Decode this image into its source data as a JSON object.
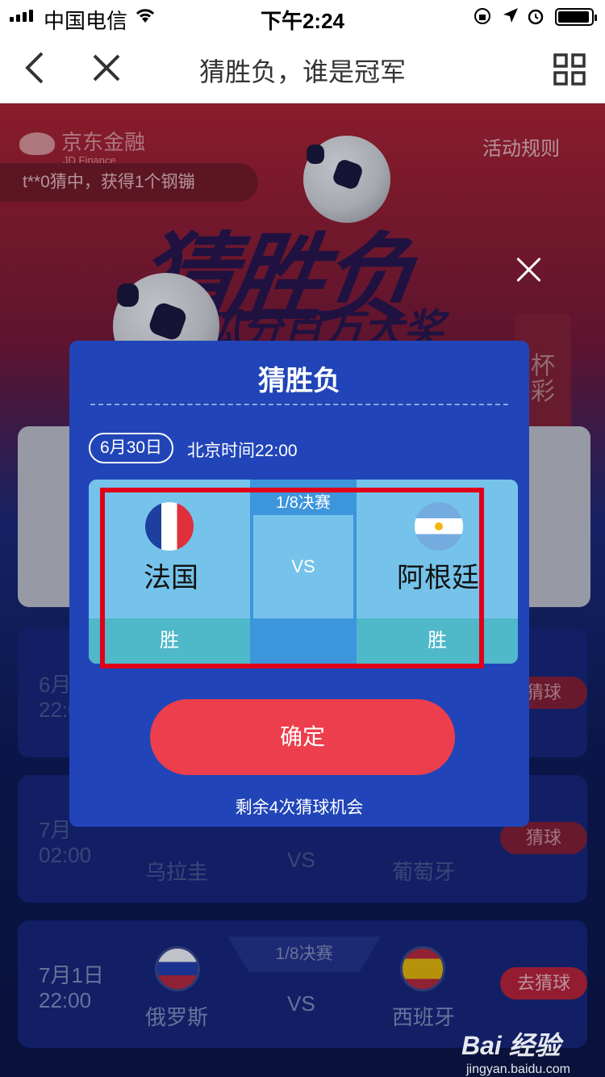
{
  "status_bar": {
    "carrier": "中国电信",
    "time": "下午2:24"
  },
  "nav": {
    "title": "猜胜负，谁是冠军"
  },
  "background": {
    "brand": "京东金融",
    "brand_en": "JD Finance",
    "rules_link": "活动规则",
    "ticker": "t**0猜中，获得1个钢镚",
    "banner_title": "猜胜负",
    "banner_sub": "瓜分百万大奖",
    "side_promo": [
      "杯",
      "彩"
    ],
    "matches": [
      {
        "date": "6月",
        "time": "22:0",
        "btn": "猜球"
      },
      {
        "date": "7月",
        "time": "02:00",
        "home": "乌拉圭",
        "vs": "VS",
        "away": "葡萄牙",
        "btn": "猜球"
      },
      {
        "date": "7月1日",
        "time": "22:00",
        "stage": "1/8决赛",
        "home": "俄罗斯",
        "vs": "VS",
        "away": "西班牙",
        "btn": "去猜球"
      }
    ]
  },
  "modal": {
    "title": "猜胜负",
    "date": "6月30日",
    "beijing_time": "北京时间22:00",
    "stage": "1/8决赛",
    "home_team": "法国",
    "away_team": "阿根廷",
    "vs": "VS",
    "home_win": "胜",
    "away_win": "胜",
    "confirm": "确定",
    "remaining": "剩余4次猜球机会"
  },
  "watermark": {
    "brand": "Bai 经验",
    "url": "jingyan.baidu.com"
  },
  "colors": {
    "modal_bg": "#2145b8",
    "confirm": "#ec3e4c",
    "highlight": "#e0001a",
    "team_bg": "#75c3ea"
  }
}
